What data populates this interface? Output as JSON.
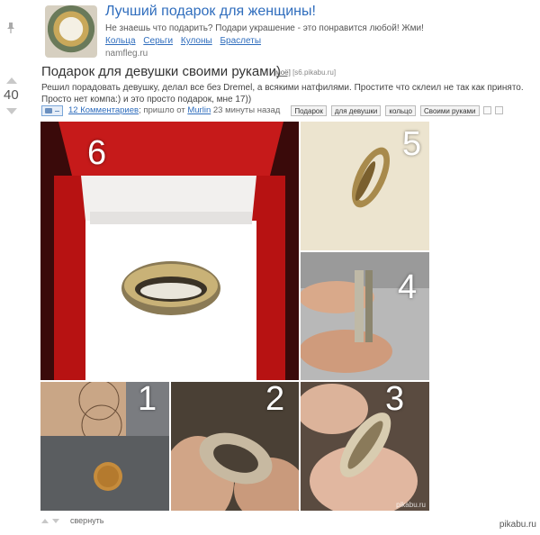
{
  "ad": {
    "title": "Лучший подарок для женщины!",
    "text": "Не знаешь что подарить? Подари украшение - это понравится любой! Жми!",
    "links": [
      "Кольца",
      "Серьги",
      "Кулоны",
      "Браслеты"
    ],
    "domain": "namfleg.ru"
  },
  "post": {
    "rating": "40",
    "title": "Подарок для девушки своими руками)",
    "mine_label": "[моё]",
    "source": "[s6.pikabu.ru]",
    "text": "Решил порадовать девушку, делал все без Dremel, а всякими натфилями. Простите что склеил не так как принято. Просто нет компа:) и это просто подарок, мне 17))",
    "comments_link": "12 Комментариев",
    "posted_prefix": "; пришло от",
    "author": "Murlin",
    "time_ago": "23 минуты назад",
    "tags": [
      "Подарок",
      "для девушки",
      "кольцо",
      "Своими руками"
    ],
    "photo_numbers": [
      "6",
      "5",
      "4",
      "1",
      "2",
      "3"
    ],
    "watermark": "pikabu.ru"
  },
  "footer": {
    "collapse": "свернуть",
    "site": "pikabu.ru"
  }
}
